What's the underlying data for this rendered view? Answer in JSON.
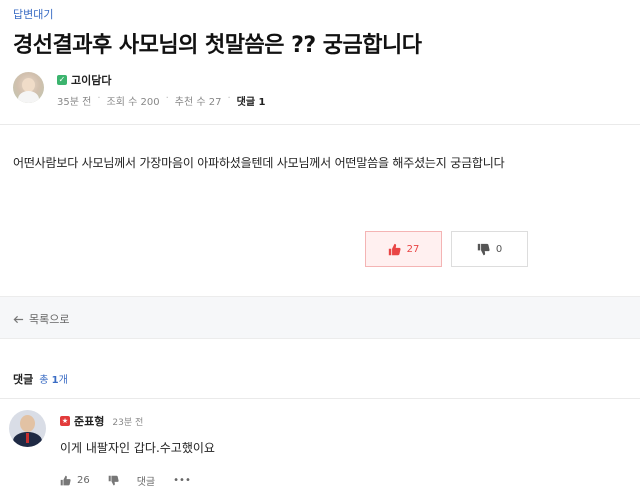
{
  "post": {
    "category": "답변대기",
    "title": "경선결과후 사모님의 첫말씀은 ?? 궁금합니다",
    "author": "고이담다",
    "time": "35분 전",
    "views_label": "조회 수",
    "views": "200",
    "recommend_label": "추천 수",
    "recommend": "27",
    "comments_label": "댓글",
    "comments": "1",
    "body": "어떤사람보다 사모님께서 가장마음이 아파하셨을텐데 사모님께서 어떤말씀을 해주셨는지 궁금합니다",
    "upvotes": "27",
    "downvotes": "0"
  },
  "nav": {
    "back_label": "목록으로"
  },
  "comments_section": {
    "label": "댓글",
    "total_prefix": "총",
    "total": "1",
    "total_suffix": "개",
    "items": [
      {
        "author": "준표형",
        "time": "23분 전",
        "text": "이게 내팔자인 갑다.수고했이요",
        "likes": "26",
        "reply_label": "댓글",
        "more_label": "•••"
      }
    ]
  },
  "colors": {
    "accent": "#3a6cc4",
    "upvote": "#e94545",
    "author_badge": "#3cb46e",
    "commenter_badge": "#e23b3b"
  },
  "icons": {
    "author_badge": "green-badge-icon",
    "commenter_badge": "red-badge-icon",
    "upvote": "thumbs-up-icon",
    "downvote": "thumbs-down-icon",
    "back": "arrow-left-icon"
  }
}
